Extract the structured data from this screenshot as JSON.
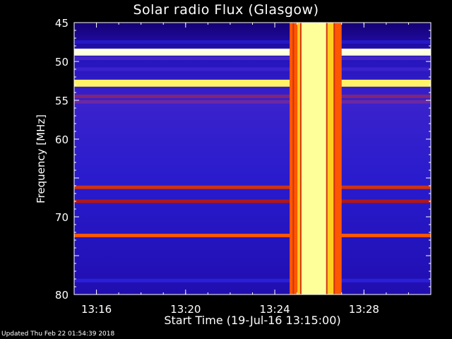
{
  "chart_data": {
    "type": "heatmap",
    "title": "Solar radio Flux (Glasgow)",
    "xlabel": "Start Time (19-Jul-16 13:15:00)",
    "ylabel": "Frequency [MHz]",
    "x_unit": "minutes",
    "x_start": "13:15:00",
    "xlim": [
      "13:15:00",
      "13:31:00"
    ],
    "ylim": [
      45,
      80
    ],
    "y_inverted": true,
    "x_ticks": [
      "13:16",
      "13:20",
      "13:24",
      "13:28"
    ],
    "y_ticks": [
      45,
      50,
      55,
      60,
      65,
      70,
      75,
      80
    ],
    "y_tick_labels": [
      "45",
      "50",
      "55",
      "60",
      "",
      "70",
      "",
      "80"
    ],
    "colormap": [
      "#000000",
      "#1a0090",
      "#2b20d8",
      "#6a2aa8",
      "#b01818",
      "#ff5a00",
      "#ffc000",
      "#ffff80",
      "#ffffff"
    ],
    "background_level": 0.18,
    "burst": {
      "start": "13:24:40",
      "end": "13:27:00",
      "peak_level": 0.9,
      "note_minute_marks": [
        "13:24:50",
        "13:25:10",
        "13:26:20",
        "13:26:40"
      ]
    },
    "interference_bands_mhz": [
      {
        "freq": 47.5,
        "level": 0.22
      },
      {
        "freq": 48.8,
        "level": 0.97
      },
      {
        "freq": 49.6,
        "level": 0.3
      },
      {
        "freq": 51.0,
        "level": 0.28
      },
      {
        "freq": 52.8,
        "level": 0.85
      },
      {
        "freq": 54.5,
        "level": 0.42
      },
      {
        "freq": 55.2,
        "level": 0.38
      },
      {
        "freq": 66.2,
        "level": 0.55
      },
      {
        "freq": 68.0,
        "level": 0.5
      },
      {
        "freq": 72.4,
        "level": 0.62
      },
      {
        "freq": 78.2,
        "level": 0.25
      }
    ]
  },
  "footer": "Updated Thu Feb 22 01:54:39 2018"
}
